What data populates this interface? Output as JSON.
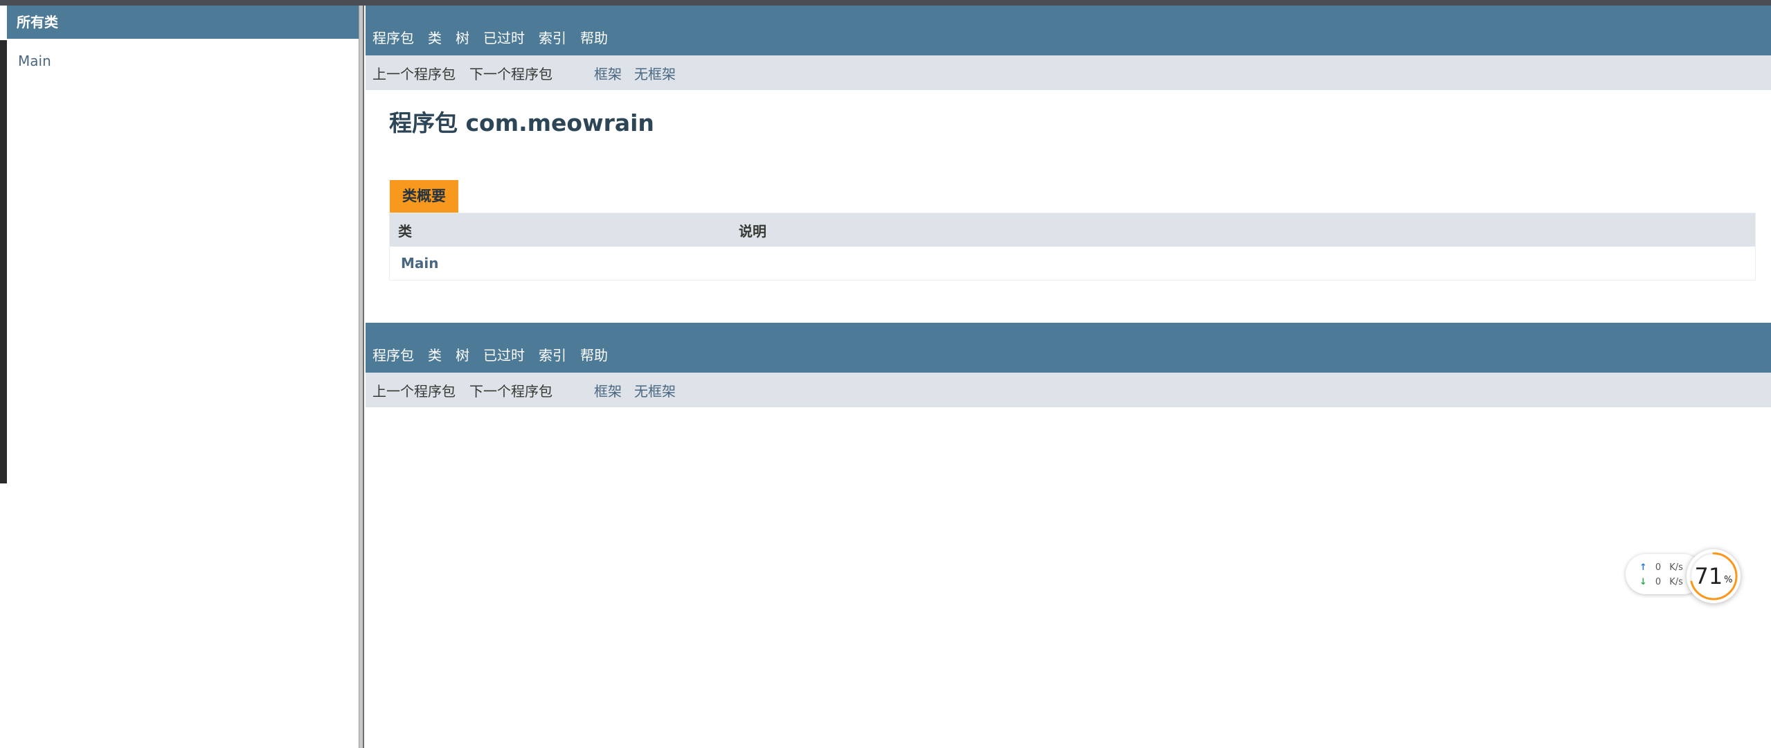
{
  "left_frame": {
    "header": "所有类",
    "classes": [
      "Main"
    ]
  },
  "nav": {
    "items": [
      "程序包",
      "类",
      "树",
      "已过时",
      "索引",
      "帮助"
    ],
    "prev": "上一个程序包",
    "next": "下一个程序包",
    "frames": "框架",
    "no_frames": "无框架"
  },
  "main": {
    "title": "程序包 com.meowrain",
    "summary_caption": "类概要",
    "columns": [
      "类",
      "说明"
    ],
    "rows": [
      {
        "name": "Main",
        "description": ""
      }
    ]
  },
  "widget": {
    "upload": "0",
    "download": "0",
    "unit": "K/s",
    "percent": "71",
    "percent_sign": "%",
    "percent_value": 71,
    "accent_color": "#f8981d"
  },
  "colors": {
    "nav_bar": "#4d7a97",
    "sub_nav": "#dee3e9",
    "caption": "#f8981d",
    "link": "#4a6782"
  }
}
